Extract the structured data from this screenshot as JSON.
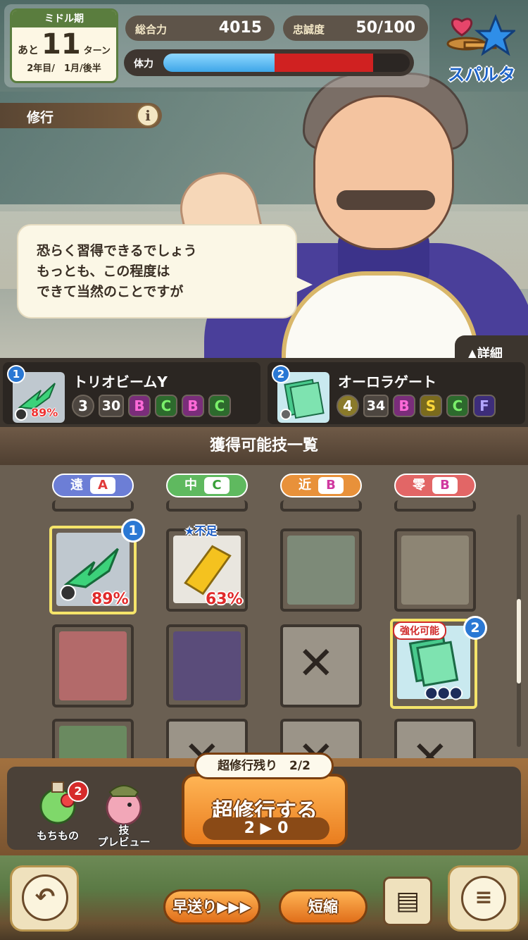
{
  "hud": {
    "period": "ミドル期",
    "turns_prefix": "あと",
    "turns_left": "11",
    "turns_suffix": "ターン",
    "date": "2年目/　1月/後半",
    "power_label": "総合力",
    "power_value": "4015",
    "loyalty_label": "忠誠度",
    "loyalty_value": "50/100",
    "stamina_label": "体力",
    "stamina_fraction": 0.45,
    "stamina_loss_fraction": 0.4,
    "mode_label": "スパルタ"
  },
  "banner": {
    "title": "修行",
    "info": "i"
  },
  "speech": {
    "lines": [
      "恐らく習得できるでしょう",
      "もっとも、この程度は",
      "できて当然のことですが"
    ]
  },
  "detail_tab": "▲詳細",
  "skills": [
    {
      "slot": "1",
      "name": "トリオビームY",
      "success": "89%",
      "cost": "3",
      "power": "30",
      "grades": [
        "B",
        "C",
        "B",
        "C"
      ]
    },
    {
      "slot": "2",
      "name": "オーロラゲート",
      "cost": "4",
      "power": "34",
      "grades": [
        "B",
        "S",
        "C",
        "F"
      ]
    }
  ],
  "panel": {
    "title": "獲得可能技一覧",
    "columns": [
      {
        "label": "遠",
        "rank": "A"
      },
      {
        "label": "中",
        "rank": "C"
      },
      {
        "label": "近",
        "rank": "B"
      },
      {
        "label": "零",
        "rank": "B"
      }
    ],
    "tiles": {
      "t1_badge": "1",
      "t1_pct": "89%",
      "t2_short": "★不足",
      "t2_pct": "63%",
      "t8_tag": "強化可能",
      "t8_badge": "2",
      "t8_dots": "●●●",
      "locked_mark": "✕"
    }
  },
  "action": {
    "items_label": "もちもの",
    "items_count": "2",
    "preview_label": "技\nプレビュー",
    "super_remaining": "超修行残り　2/2",
    "super_button": "超修行する",
    "super_cost": "2 ▶ 0"
  },
  "nav": {
    "back_icon": "↶",
    "fast_forward": "早送り▶▶▶",
    "shorten": "短縮",
    "log_icon": "▤",
    "menu_icon": "≡"
  }
}
